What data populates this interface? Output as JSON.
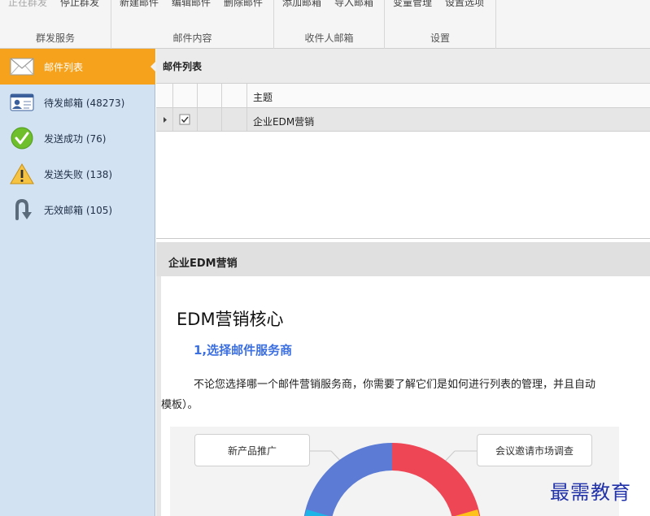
{
  "ribbon": {
    "groups": [
      {
        "label": "群发服务",
        "buttons": [
          {
            "label": "正在群发",
            "disabled": true
          },
          {
            "label": "停止群发",
            "disabled": false
          }
        ]
      },
      {
        "label": "邮件内容",
        "buttons": [
          {
            "label": "新建邮件"
          },
          {
            "label": "编辑邮件"
          },
          {
            "label": "删除邮件"
          }
        ]
      },
      {
        "label": "收件人邮箱",
        "buttons": [
          {
            "label": "添加邮箱"
          },
          {
            "label": "导入邮箱"
          }
        ]
      },
      {
        "label": "设置",
        "buttons": [
          {
            "label": "变量管理"
          },
          {
            "label": "设置选项"
          }
        ]
      }
    ]
  },
  "sidebar": {
    "items": [
      {
        "label": "邮件列表",
        "icon": "envelope-icon",
        "active": true
      },
      {
        "label": "待发邮箱 (48273)",
        "icon": "contact-card-icon"
      },
      {
        "label": "发送成功 (76)",
        "icon": "checkmark-icon"
      },
      {
        "label": "发送失败 (138)",
        "icon": "warning-icon"
      },
      {
        "label": "无效邮箱 (105)",
        "icon": "return-arrow-icon"
      }
    ]
  },
  "list_panel": {
    "title": "邮件列表",
    "columns": {
      "subject": "主题"
    },
    "rows": [
      {
        "checked": true,
        "subject": "企业EDM营销"
      }
    ]
  },
  "preview": {
    "title": "企业EDM营销",
    "heading": "EDM营销核心",
    "subheading": "1,选择邮件服务商",
    "paragraph_line1": "不论您选择哪一个邮件营销服务商，你需要了解它们是如何进行列表的管理，并且自动",
    "paragraph_line2": "模板）。",
    "infographic": {
      "left_label": "新产品推广",
      "right_label": "会议邀请市场调查"
    }
  },
  "watermark": "最需教育",
  "colors": {
    "accent": "#f7a21c",
    "sidebar_bg": "#d3e2f3",
    "link_blue": "#3c6fe0"
  }
}
